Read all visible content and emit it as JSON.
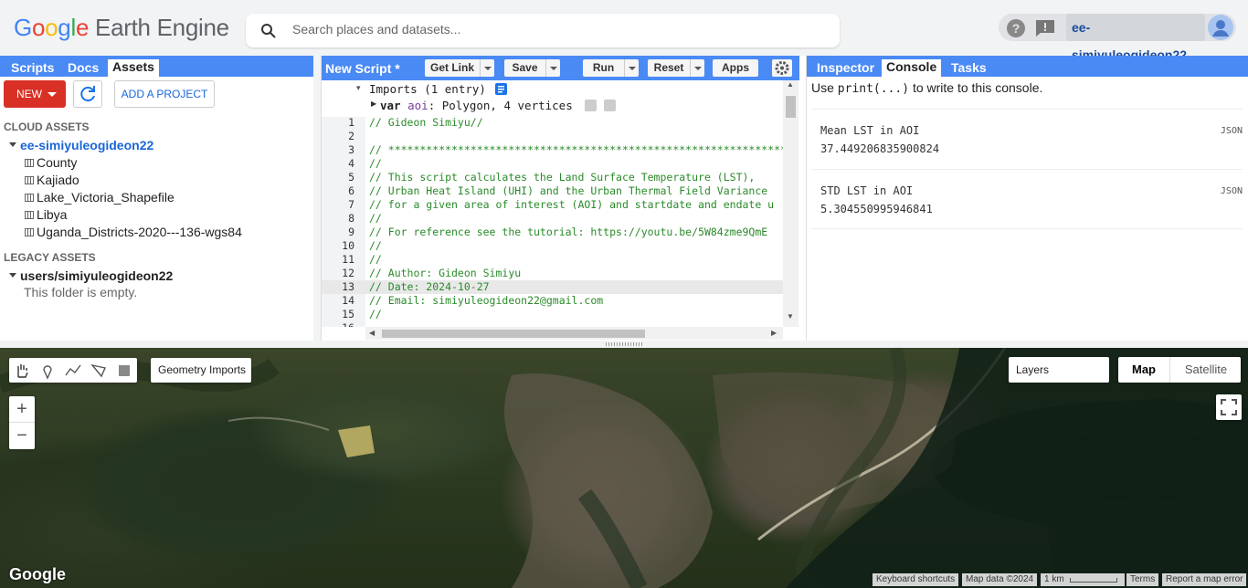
{
  "header": {
    "logo_google": "Google",
    "logo_rest": "Earth Engine",
    "search_placeholder": "Search places and datasets...",
    "username": "ee-simiyuleogideon22"
  },
  "left_panel": {
    "tabs": [
      "Scripts",
      "Docs",
      "Assets"
    ],
    "active_tab": "Assets",
    "new_label": "NEW",
    "add_project_label": "ADD A PROJECT",
    "cloud_assets_heading": "CLOUD ASSETS",
    "cloud_root": "ee-simiyuleogideon22",
    "cloud_items": [
      "County",
      "Kajiado",
      "Lake_Victoria_Shapefile",
      "Libya",
      "Uganda_Districts-2020---136-wgs84"
    ],
    "legacy_heading": "LEGACY ASSETS",
    "legacy_root": "users/simiyuleogideon22",
    "legacy_empty": "This folder is empty."
  },
  "editor": {
    "title": "New Script *",
    "buttons": [
      "Get Link",
      "Save",
      "Run",
      "Reset",
      "Apps"
    ],
    "imports_summary": "Imports (1 entry)",
    "import_var": "var",
    "import_name": "aoi",
    "import_desc": ": Polygon, 4 vertices",
    "lines": [
      {
        "n": "1",
        "text": "// Gideon Simiyu//"
      },
      {
        "n": "2",
        "text": ""
      },
      {
        "n": "3",
        "text": "// ****************************************************************"
      },
      {
        "n": "4",
        "text": "//"
      },
      {
        "n": "5",
        "text": "// This script calculates the Land Surface Temperature (LST),"
      },
      {
        "n": "6",
        "text": "// Urban Heat Island (UHI) and the Urban Thermal Field Variance"
      },
      {
        "n": "7",
        "text": "// for a given area of interest (AOI) and startdate and endate u"
      },
      {
        "n": "8",
        "text": "//"
      },
      {
        "n": "9",
        "text": "// For reference see the tutorial: https://youtu.be/5W84zme9QmE"
      },
      {
        "n": "10",
        "text": "//"
      },
      {
        "n": "11",
        "text": "//"
      },
      {
        "n": "12",
        "text": "// Author: Gideon Simiyu"
      },
      {
        "n": "13",
        "text": "// Date: 2024-10-27"
      },
      {
        "n": "14",
        "text": "// Email: simiyuleogideon22@gmail.com"
      },
      {
        "n": "15",
        "text": "//"
      },
      {
        "n": "16",
        "text": ""
      }
    ]
  },
  "console": {
    "tabs": [
      "Inspector",
      "Console",
      "Tasks"
    ],
    "active_tab": "Console",
    "hint_pre": "Use ",
    "hint_code": "print(...)",
    "hint_post": " to write to this console.",
    "entries": [
      {
        "label": "Mean LST in AOI",
        "value": "37.449206835900824",
        "tag": "JSON"
      },
      {
        "label": "STD LST in AOI",
        "value": "5.304550995946841",
        "tag": "JSON"
      }
    ]
  },
  "map": {
    "geometry_imports_label": "Geometry Imports",
    "layers_label": "Layers",
    "map_label": "Map",
    "satellite_label": "Satellite",
    "zoom_in": "+",
    "zoom_out": "−",
    "google_logo": "Google",
    "attribution": [
      "Keyboard shortcuts",
      "Map data ©2024",
      "1 km",
      "Terms",
      "Report a map error"
    ]
  },
  "colors": {
    "tab_blue": "#4a8af4",
    "new_red": "#d93025",
    "comment_green": "#2a8a2a"
  }
}
